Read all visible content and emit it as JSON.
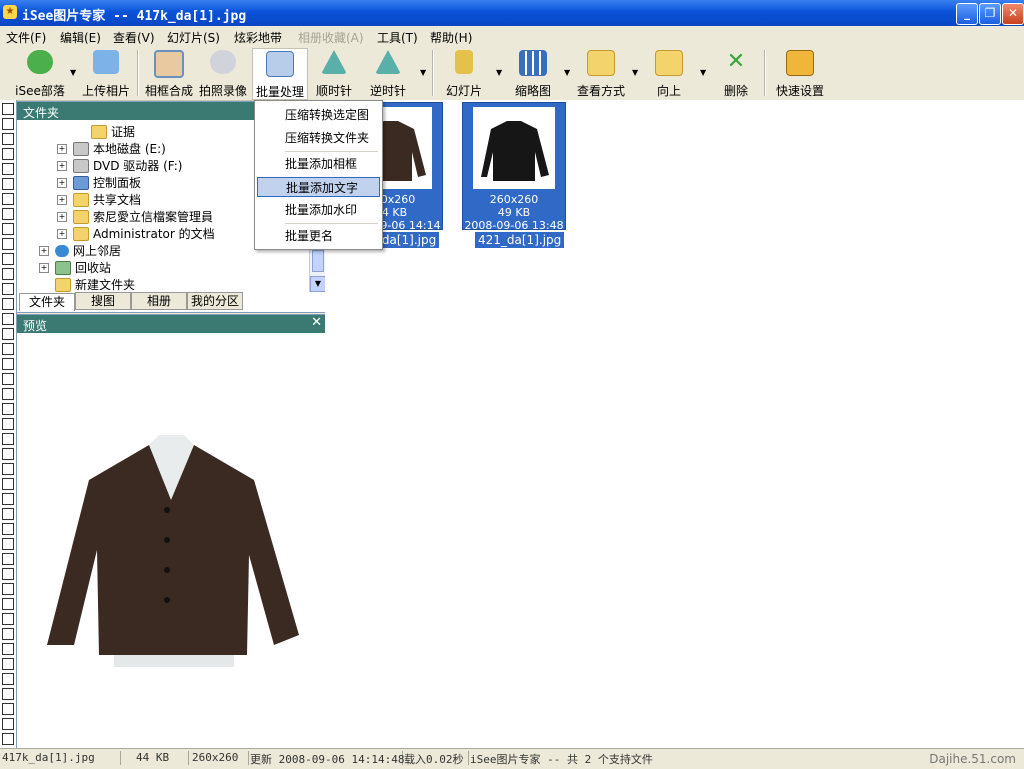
{
  "window": {
    "title": "iSee图片专家 -- 417k_da[1].jpg"
  },
  "menu": [
    {
      "label": "文件(F)",
      "enabled": true
    },
    {
      "label": "编辑(E)",
      "enabled": true
    },
    {
      "label": "查看(V)",
      "enabled": true
    },
    {
      "label": "幻灯片(S)",
      "enabled": true
    },
    {
      "label": "炫彩地带",
      "enabled": true
    },
    {
      "label": "相册收藏(A)",
      "enabled": false
    },
    {
      "label": "工具(T)",
      "enabled": true
    },
    {
      "label": "帮助(H)",
      "enabled": true
    }
  ],
  "toolbar": {
    "isee_tribe": "iSee部落",
    "upload": "上传相片",
    "frame_compose": "相框合成",
    "capture": "拍照录像",
    "batch": "批量处理",
    "rotate_cw": "顺时针",
    "rotate_ccw": "逆时针",
    "slideshow": "幻灯片",
    "thumbnail": "缩略图",
    "view_mode": "查看方式",
    "up": "向上",
    "delete": "删除",
    "quick_settings": "快速设置"
  },
  "batch_menu": [
    {
      "label": "压缩转换选定图"
    },
    {
      "label": "压缩转换文件夹"
    },
    {
      "label": "批量添加相框"
    },
    {
      "label": "批量添加文字",
      "highlighted": true
    },
    {
      "label": "批量添加水印"
    },
    {
      "label": "批量更名"
    }
  ],
  "folder_panel": {
    "title": "文件夹",
    "tree": [
      {
        "label": "证据",
        "indent": 3,
        "icon": "folder-icon",
        "expander": ""
      },
      {
        "label": "本地磁盘 (E:)",
        "indent": 2,
        "icon": "drive-icon",
        "expander": "+"
      },
      {
        "label": "DVD 驱动器 (F:)",
        "indent": 2,
        "icon": "drive-icon",
        "expander": "+"
      },
      {
        "label": "控制面板",
        "indent": 2,
        "icon": "control-panel-icon",
        "expander": "+"
      },
      {
        "label": "共享文档",
        "indent": 2,
        "icon": "folder-icon",
        "expander": "+"
      },
      {
        "label": "索尼愛立信檔案管理員",
        "indent": 2,
        "icon": "folder-icon",
        "expander": "+"
      },
      {
        "label": "Administrator 的文档",
        "indent": 2,
        "icon": "folder-icon",
        "expander": "+"
      },
      {
        "label": "网上邻居",
        "indent": 1,
        "icon": "network-icon",
        "expander": "+"
      },
      {
        "label": "回收站",
        "indent": 1,
        "icon": "recycle-bin-icon",
        "expander": "+"
      },
      {
        "label": "新建文件夹",
        "indent": 1,
        "icon": "folder-icon",
        "expander": ""
      }
    ],
    "tabs": [
      "文件夹",
      "搜图",
      "相册",
      "我的分区"
    ]
  },
  "preview_panel": {
    "title": "预览"
  },
  "thumbnails": [
    {
      "size": "260x260",
      "filesize": "44 KB",
      "date": "2008-09-06 14:14",
      "name": "417k_da[1].jpg",
      "jacket_color": "#3b2a22"
    },
    {
      "size": "260x260",
      "filesize": "49 KB",
      "date": "2008-09-06 13:48",
      "name": "421_da[1].jpg",
      "jacket_color": "#161616"
    }
  ],
  "status": {
    "file": "417k_da[1].jpg",
    "filesize": "44 KB",
    "dimensions": "260x260",
    "updated": "更新 2008-09-06 14:14:48",
    "load": "载入0.02秒",
    "summary": "iSee图片专家 -- 共 2 个支持文件"
  },
  "watermark": "Dajihe.51.com",
  "colors": {
    "title_bar": "#0a53d8",
    "panel_header": "#3a7a73",
    "selection": "#3169c6"
  }
}
